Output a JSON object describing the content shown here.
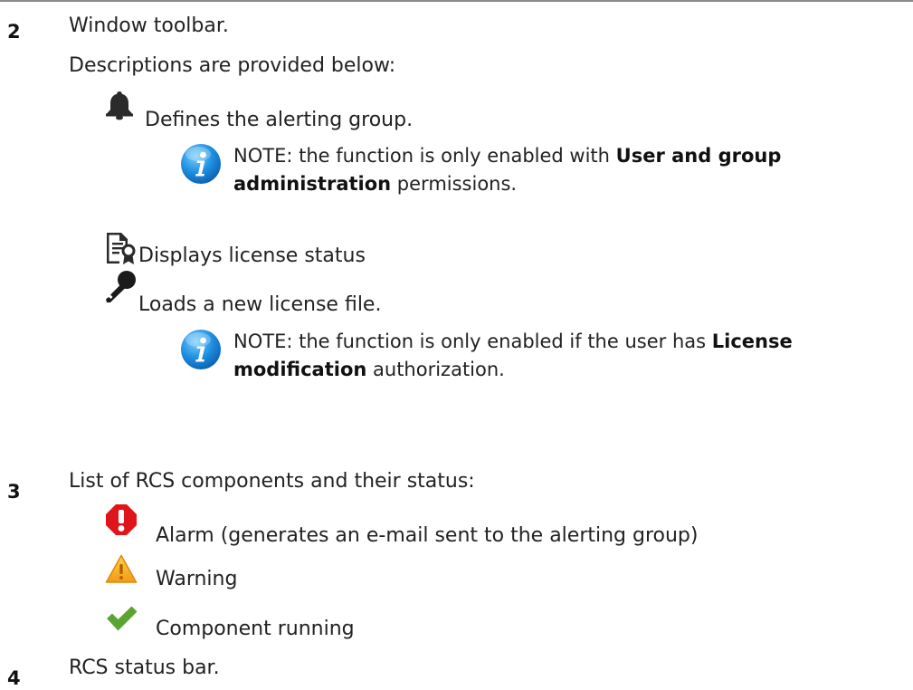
{
  "items": [
    {
      "number": "2",
      "title": "Window toolbar.",
      "intro": "Descriptions are provided below:",
      "entries": [
        {
          "icon": "bell-icon",
          "text": "Defines the alerting group.",
          "note": {
            "icon": "info-icon",
            "line1_prefix": "NOTE: the function is only enabled with ",
            "line1_bold": "User and group",
            "line2_bold": "administration",
            "line2_suffix": " permissions."
          }
        },
        {
          "icon": "license-certificate-icon",
          "text": "Displays license status"
        },
        {
          "icon": "key-icon",
          "text": "Loads a new license file.",
          "note": {
            "icon": "info-icon",
            "line1_prefix": "NOTE: the function is only enabled if the user has ",
            "line1_bold": "License",
            "line2_bold": "modification",
            "line2_suffix": " authorization."
          }
        }
      ]
    },
    {
      "number": "3",
      "title": "List of RCS components and their status:",
      "statuses": [
        {
          "icon": "alarm-exclamation-icon",
          "text": "Alarm (generates an e-mail sent to the alerting group)",
          "color": "#e0151b"
        },
        {
          "icon": "warning-triangle-icon",
          "text": "Warning",
          "color": "#f2a21f"
        },
        {
          "icon": "checkmark-icon",
          "text": "Component running",
          "color": "#5aa532"
        }
      ]
    },
    {
      "number": "4",
      "title": "RCS status bar."
    }
  ]
}
